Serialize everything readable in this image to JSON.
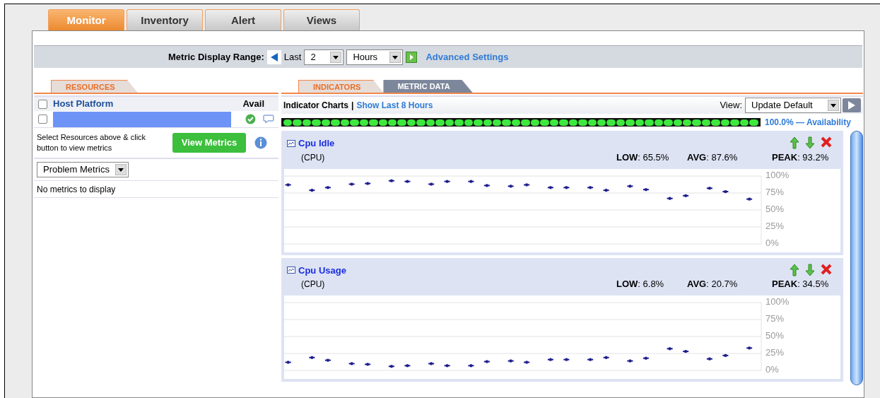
{
  "tabs": [
    {
      "label": "Monitor",
      "selected": true
    },
    {
      "label": "Inventory",
      "selected": false
    },
    {
      "label": "Alert",
      "selected": false
    },
    {
      "label": "Views",
      "selected": false
    }
  ],
  "range_bar": {
    "label": "Metric Display Range:",
    "last": "Last",
    "count": "2",
    "unit": "Hours",
    "link": "Advanced Settings"
  },
  "resources": {
    "tabs": [
      {
        "label": "RESOURCES",
        "selected": true
      }
    ],
    "header": {
      "checked": false,
      "column_1": "Host Platform",
      "column_2": "Avail"
    },
    "rows": [
      {
        "checked": false,
        "available": true
      }
    ],
    "hint": "Select Resources above & click button to view metrics",
    "button": "View Metrics",
    "filter": "Problem Metrics",
    "empty": "No metrics to display"
  },
  "indicators": {
    "tabs": [
      {
        "label": "INDICATORS",
        "selected": true
      },
      {
        "label": "METRIC DATA",
        "selected": false
      }
    ],
    "title": "Indicator Charts",
    "separator": "|",
    "link": "Show Last 8 Hours",
    "view_label": "View:",
    "view": "Update Default",
    "availability": {
      "level": 1,
      "text": "100.0% — Availability"
    },
    "charts": [
      {
        "name": "Cpu Idle",
        "unit": "(CPU)",
        "low": "**LOW**: 65.5%",
        "avg": "**AVG**: 87.6%",
        "peak": "**PEAK**: 93.2%",
        "chart_data": {
          "type": "scatter",
          "grid": true,
          "categories": [
            null,
            null,
            null,
            null,
            null,
            null,
            null,
            null,
            null,
            null,
            null,
            null,
            null,
            null,
            null,
            null,
            null,
            null,
            null,
            null,
            null,
            null,
            null,
            null,
            null,
            null,
            null,
            null,
            null,
            null,
            null,
            null,
            null,
            null,
            null,
            null,
            null,
            null,
            null,
            null,
            null,
            null,
            null,
            null,
            null,
            null,
            null,
            null,
            null,
            null,
            null,
            null,
            null,
            null,
            null,
            null,
            null,
            null,
            null,
            null
          ],
          "ylim": [
            0,
            100
          ],
          "yticks": [
            {
              "value": 100,
              "label": "100%"
            },
            {
              "value": 75,
              "label": "75%"
            },
            {
              "value": 50,
              "label": "50%"
            },
            {
              "value": 25,
              "label": "25%"
            },
            {
              "value": 0,
              "label": "0%"
            }
          ],
          "series": [
            {
              "color": "#1a1a8c",
              "values": [
                87,
                null,
                null,
                79,
                null,
                83,
                null,
                null,
                88,
                null,
                89,
                null,
                null,
                93,
                null,
                92,
                null,
                null,
                88,
                null,
                92,
                null,
                null,
                92,
                null,
                86,
                null,
                null,
                85,
                null,
                87,
                null,
                null,
                83,
                null,
                83,
                null,
                null,
                83,
                null,
                79,
                null,
                null,
                85,
                null,
                80,
                null,
                null,
                67,
                null,
                71,
                null,
                null,
                82,
                null,
                77,
                null,
                null,
                66,
                null
              ]
            }
          ]
        }
      },
      {
        "name": "Cpu Usage",
        "unit": "(CPU)",
        "low": "**LOW**: 6.8%",
        "avg": "**AVG**: 20.7%",
        "peak": "**PEAK**: 34.5%",
        "chart_data": {
          "type": "scatter",
          "grid": true,
          "categories": [
            null,
            null,
            null,
            null,
            null,
            null,
            null,
            null,
            null,
            null,
            null,
            null,
            null,
            null,
            null,
            null,
            null,
            null,
            null,
            null,
            null,
            null,
            null,
            null,
            null,
            null,
            null,
            null,
            null,
            null,
            null,
            null,
            null,
            null,
            null,
            null,
            null,
            null,
            null,
            null,
            null,
            null,
            null,
            null,
            null,
            null,
            null,
            null,
            null,
            null,
            null,
            null,
            null,
            null,
            null,
            null,
            null,
            null,
            null,
            null
          ],
          "ylim": [
            0,
            100
          ],
          "yticks": [
            {
              "value": 100,
              "label": "100%"
            },
            {
              "value": 75,
              "label": "75%"
            },
            {
              "value": 50,
              "label": "50%"
            },
            {
              "value": 25,
              "label": "25%"
            },
            {
              "value": 0,
              "label": "0%"
            }
          ],
          "series": [
            {
              "color": "#1a1a8c",
              "values": [
                12,
                null,
                null,
                19,
                null,
                15,
                null,
                null,
                10,
                null,
                9,
                null,
                null,
                6,
                null,
                7,
                null,
                null,
                10,
                null,
                7,
                null,
                null,
                7,
                null,
                13,
                null,
                null,
                14,
                null,
                12,
                null,
                null,
                16,
                null,
                16,
                null,
                null,
                16,
                null,
                19,
                null,
                null,
                14,
                null,
                18,
                null,
                null,
                32,
                null,
                28,
                null,
                null,
                17,
                null,
                22,
                null,
                null,
                33,
                null
              ]
            }
          ]
        }
      }
    ]
  }
}
